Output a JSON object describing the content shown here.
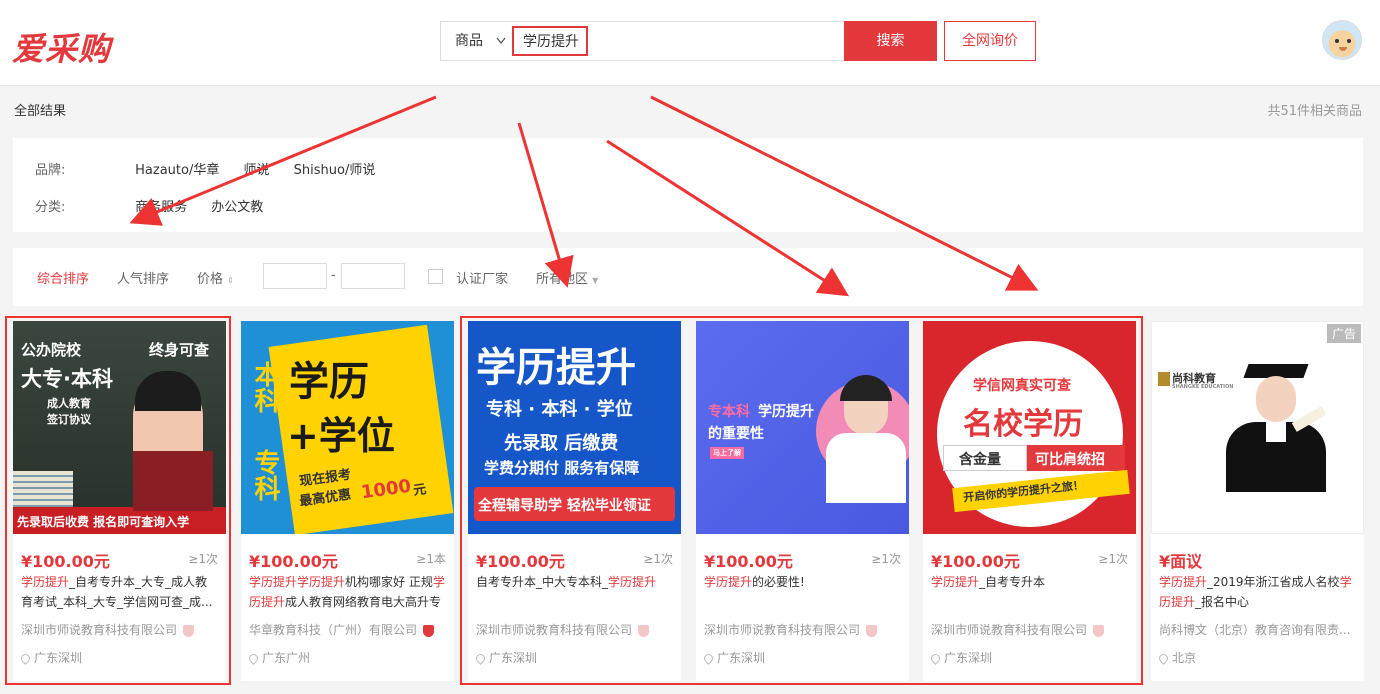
{
  "header": {
    "logo": "爱采购",
    "search_type": "商品",
    "search_value": "学历提升",
    "search_button": "搜索",
    "inquiry_button": "全网询价"
  },
  "results": {
    "label": "全部结果",
    "count": "共51件相关商品"
  },
  "filters": {
    "brand_label": "品牌:",
    "brands": [
      "Hazauto/华章",
      "师说",
      "Shishuo/师说"
    ],
    "category_label": "分类:",
    "categories": [
      "商务服务",
      "办公文教"
    ]
  },
  "sort": {
    "comprehensive": "综合排序",
    "popularity": "人气排序",
    "price": "价格",
    "price_sep": "-",
    "verified": "认证厂家",
    "region": "所有地区"
  },
  "cards": [
    {
      "img": {
        "t1": "公办院校",
        "t2": "终身可查",
        "t3": "大专·本科",
        "t4": "成人教育",
        "t5": "签订协议",
        "t6": "先录取后收费 报名即可查询入学"
      },
      "price": "¥100.00元",
      "min": "≥1次",
      "title_kw": "学历提升",
      "title_rest": "_自考专升本_大专_成人教育考试_本科_大专_学信网可查_成...",
      "company": "深圳市师说教育科技有限公司",
      "location": "广东深圳"
    },
    {
      "img": {
        "t1": "学历",
        "t2": "+学位",
        "t3": "本科",
        "t4": "专科",
        "t5": "现在报考",
        "t6": "最高优惠",
        "t7": "1000",
        "t8": "元"
      },
      "price": "¥100.00元",
      "min": "≥1本",
      "title_kw": "学历提升",
      "title_mid_kw": "学历提升",
      "title_rest": "机构哪家好 正规",
      "title_kw2": "学历提升",
      "title_rest2": "成人教育网络教育电大高升专",
      "company": "华章教育科技（广州）有限公司",
      "location": "广东广州"
    },
    {
      "img": {
        "t1": "学历提升",
        "t2": "专科 · 本科 · 学位",
        "t3": "先录取 后缴费",
        "t4": "学费分期付 服务有保障",
        "t5": "全程辅导助学 轻松毕业领证"
      },
      "price": "¥100.00元",
      "min": "≥1次",
      "title_pre": "自考专升本_中大专本科_",
      "title_kw": "学历提升",
      "company": "深圳市师说教育科技有限公司",
      "location": "广东深圳"
    },
    {
      "img": {
        "t1": "专本科",
        "t2": "学历提升",
        "t3": "的重要性",
        "t4": "马上了解"
      },
      "price": "¥100.00元",
      "min": "≥1次",
      "title_kw": "学历提升",
      "title_rest": "的必要性!",
      "company": "深圳市师说教育科技有限公司",
      "location": "广东深圳"
    },
    {
      "img": {
        "t1": "学信网真实可查",
        "t2": "名校学历",
        "t3": "含金量",
        "t4": "可比肩统招",
        "t5": "开启你的学历提升之旅！"
      },
      "price": "¥100.00元",
      "min": "≥1次",
      "title_kw": "学历提升",
      "title_rest": "_自考专升本",
      "company": "深圳市师说教育科技有限公司",
      "location": "广东深圳"
    },
    {
      "img": {
        "t1": "尚科教育",
        "t2": "SHANGKE EDUCATION"
      },
      "ad": "广告",
      "price": "¥面议",
      "title_kw": "学历提升",
      "title_pre": "",
      "title_rest": "_2019年浙江省成人名校",
      "title_kw2": "学历提升",
      "title_rest2": "_报名中心",
      "company": "尚科博文（北京）教育咨询有限责...",
      "location": "北京"
    }
  ],
  "colors": {
    "accent": "#e4393c",
    "annotation": "#e33"
  }
}
